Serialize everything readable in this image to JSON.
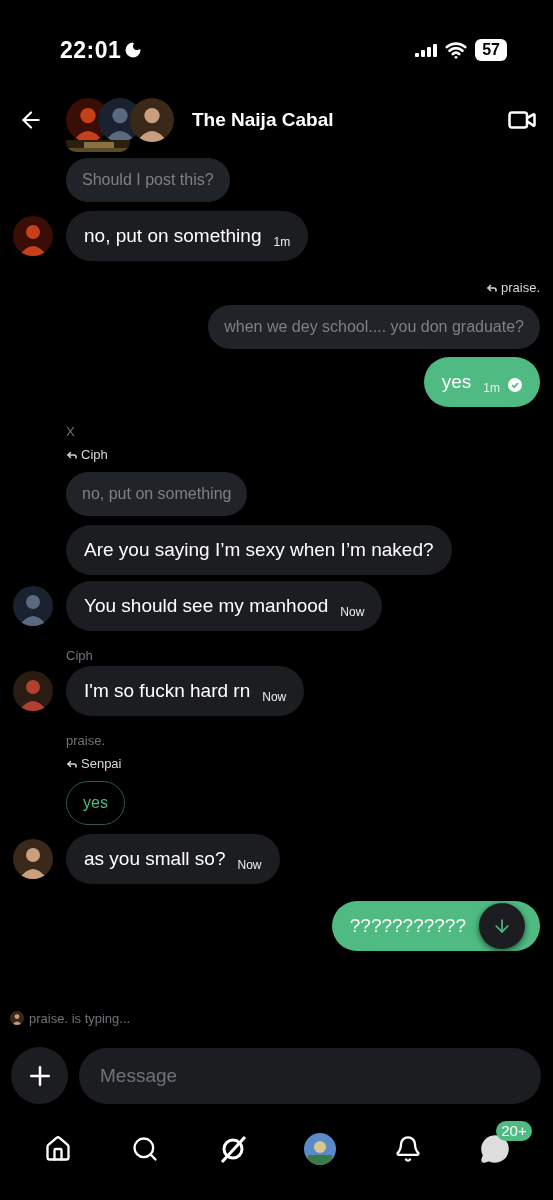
{
  "status_bar": {
    "time": "22:01",
    "battery": "57"
  },
  "header": {
    "title": "The Naija Cabal"
  },
  "messages": [
    {
      "kind": "image_strip"
    },
    {
      "kind": "quote",
      "outgoing": false,
      "own": false,
      "text": "Should I post this?"
    },
    {
      "kind": "incoming",
      "avatar": true,
      "text": "no, put on something",
      "time": "1m"
    },
    {
      "kind": "reply_to",
      "outgoing": true,
      "text": "praise."
    },
    {
      "kind": "quote",
      "outgoing": true,
      "own": false,
      "text": "when we dey school.... you don graduate?"
    },
    {
      "kind": "outgoing",
      "text": "yes",
      "time": "1m",
      "read": true
    },
    {
      "kind": "sender",
      "text": "X"
    },
    {
      "kind": "reply_to",
      "outgoing": false,
      "text": "Ciph"
    },
    {
      "kind": "quote",
      "outgoing": false,
      "own": false,
      "text": "no, put on something"
    },
    {
      "kind": "incoming",
      "avatar": false,
      "text": "Are you saying I’m sexy when I’m naked?"
    },
    {
      "kind": "incoming",
      "avatar": true,
      "text": "You should see my manhood",
      "time": "Now"
    },
    {
      "kind": "sender",
      "text": "Ciph"
    },
    {
      "kind": "incoming",
      "avatar": true,
      "text": "I'm so fuckn hard rn",
      "time": "Now"
    },
    {
      "kind": "sender",
      "text": "praise."
    },
    {
      "kind": "reply_to",
      "outgoing": false,
      "text": "Senpai"
    },
    {
      "kind": "quote",
      "outgoing": false,
      "own": true,
      "text": "yes"
    },
    {
      "kind": "incoming",
      "avatar": true,
      "text": "as you small so?",
      "time": "Now"
    },
    {
      "kind": "outgoing",
      "text": "???????????",
      "read": false
    }
  ],
  "typing": "praise. is typing...",
  "composer": {
    "placeholder": "Message"
  },
  "nav": {
    "badge": "20+"
  }
}
